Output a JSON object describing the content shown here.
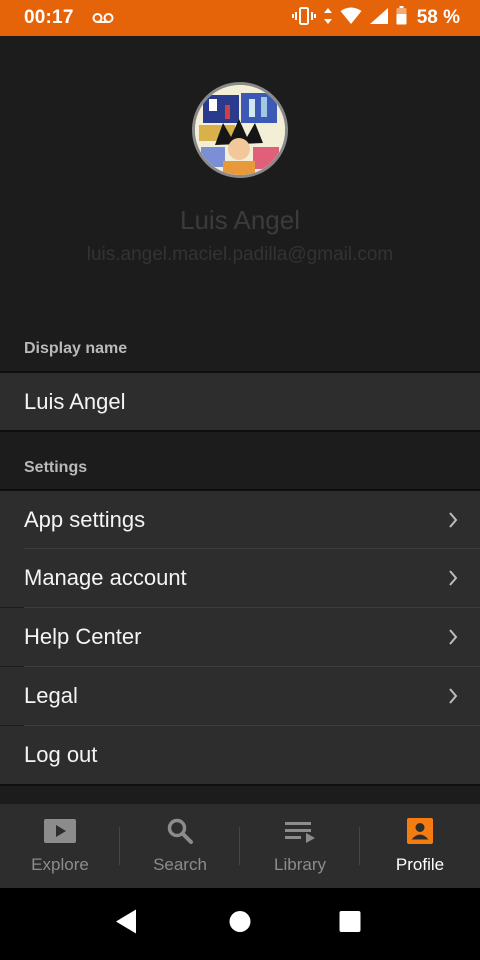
{
  "status_bar": {
    "time": "00:17",
    "battery_percent": "58 %",
    "icons": [
      "voicemail-icon",
      "vibrate-icon",
      "data-arrows-icon",
      "wifi-icon",
      "cell-signal-icon",
      "battery-icon"
    ],
    "color": "#e5640a"
  },
  "profile": {
    "name": "Luis Angel",
    "email": "luis.angel.maciel.padilla@gmail.com"
  },
  "display_name_section": {
    "label": "Display name",
    "value": "Luis Angel"
  },
  "settings_section": {
    "label": "Settings",
    "items": [
      {
        "label": "App settings",
        "chevron": true
      },
      {
        "label": "Manage account",
        "chevron": true
      },
      {
        "label": "Help Center",
        "chevron": true
      },
      {
        "label": "Legal",
        "chevron": true
      },
      {
        "label": "Log out",
        "chevron": false
      }
    ]
  },
  "bottom_nav": {
    "items": [
      {
        "label": "Explore",
        "icon": "play-icon",
        "active": false
      },
      {
        "label": "Search",
        "icon": "search-icon",
        "active": false
      },
      {
        "label": "Library",
        "icon": "library-icon",
        "active": false
      },
      {
        "label": "Profile",
        "icon": "profile-icon",
        "active": true
      }
    ],
    "accent": "#f57c12"
  },
  "system_nav": {
    "buttons": [
      "back-icon",
      "home-icon",
      "recents-icon"
    ]
  }
}
